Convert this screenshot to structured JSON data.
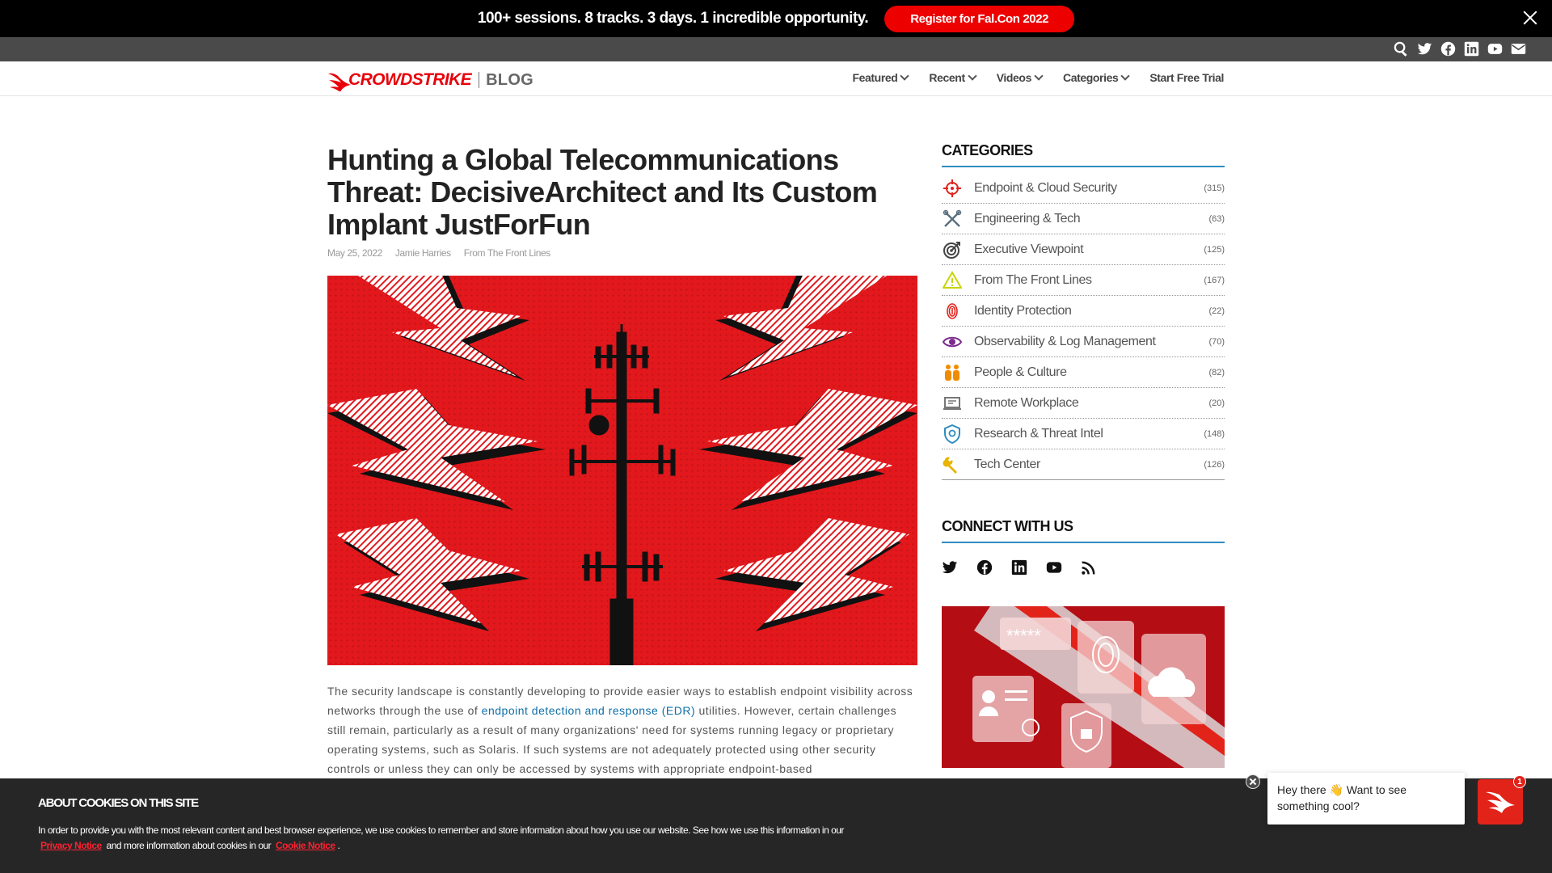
{
  "promo": {
    "text": "100+ sessions. 8 tracks. 3 days. 1 incredible opportunity.",
    "button": "Register for Fal.Con 2022"
  },
  "social_top": [
    "search-icon",
    "twitter-icon",
    "facebook-icon",
    "linkedin-icon",
    "youtube-icon",
    "email-icon"
  ],
  "nav": {
    "logo_word": "CROWDSTRIKE",
    "logo_blog": "BLOG",
    "menu": [
      "Featured",
      "Recent",
      "Videos",
      "Categories",
      "Start Free Trial"
    ]
  },
  "article": {
    "title": "Hunting a Global Telecommunications Threat: DecisiveArchitect and Its Custom Implant JustForFun",
    "date": "May 25, 2022",
    "author": "Jamie Harries",
    "category": "From The Front Lines",
    "body_before_link": "The security landscape is constantly developing to provide easier ways to establish endpoint visibility across networks through the use of ",
    "body_link": "endpoint detection and response (EDR)",
    "body_after_link": " utilities. However, certain challenges still remain, particularly as a result of many organizations' need for systems running legacy or proprietary operating systems, such as Solaris. If such systems are not adequately protected using other security controls or unless they can only be accessed by systems with appropriate endpoint-based"
  },
  "sidebar": {
    "categories_heading": "CATEGORIES",
    "categories": [
      {
        "label": "Endpoint & Cloud Security",
        "count": "(315)",
        "icon": "crosshair-icon",
        "color": "#e2231a"
      },
      {
        "label": "Engineering & Tech",
        "count": "(63)",
        "icon": "tools-icon",
        "color": "#5a6f7e"
      },
      {
        "label": "Executive Viewpoint",
        "count": "(125)",
        "icon": "target-icon",
        "color": "#444444"
      },
      {
        "label": "From The Front Lines",
        "count": "(167)",
        "icon": "warning-icon",
        "color": "#c8d400"
      },
      {
        "label": "Identity Protection",
        "count": "(22)",
        "icon": "fingerprint-icon",
        "color": "#e2231a"
      },
      {
        "label": "Observability & Log Management",
        "count": "(70)",
        "icon": "eye-icon",
        "color": "#7b2b8f"
      },
      {
        "label": "People & Culture",
        "count": "(82)",
        "icon": "people-icon",
        "color": "#f08c00"
      },
      {
        "label": "Remote Workplace",
        "count": "(20)",
        "icon": "laptop-icon",
        "color": "#777777"
      },
      {
        "label": "Research & Threat Intel",
        "count": "(148)",
        "icon": "shield-icon",
        "color": "#2f8dbf"
      },
      {
        "label": "Tech Center",
        "count": "(126)",
        "icon": "wrench-icon",
        "color": "#e8b400"
      }
    ],
    "connect_heading": "CONNECT WITH US",
    "connect_icons": [
      "twitter-icon",
      "facebook-icon",
      "linkedin-icon",
      "youtube-icon",
      "rss-icon"
    ]
  },
  "cookie": {
    "heading": "ABOUT COOKIES ON THIS SITE",
    "text_before": "In order to provide you with the most relevant content and best browser experience, we use cookies to remember and store information about how you use our website. See how we use this information in our ",
    "privacy_link": "Privacy Notice",
    "text_middle": " and more information about cookies in our ",
    "cookie_link": "Cookie Notice",
    "text_after": "."
  },
  "chat": {
    "message": "Hey there 👋 Want to see something cool?",
    "badge": "1"
  }
}
